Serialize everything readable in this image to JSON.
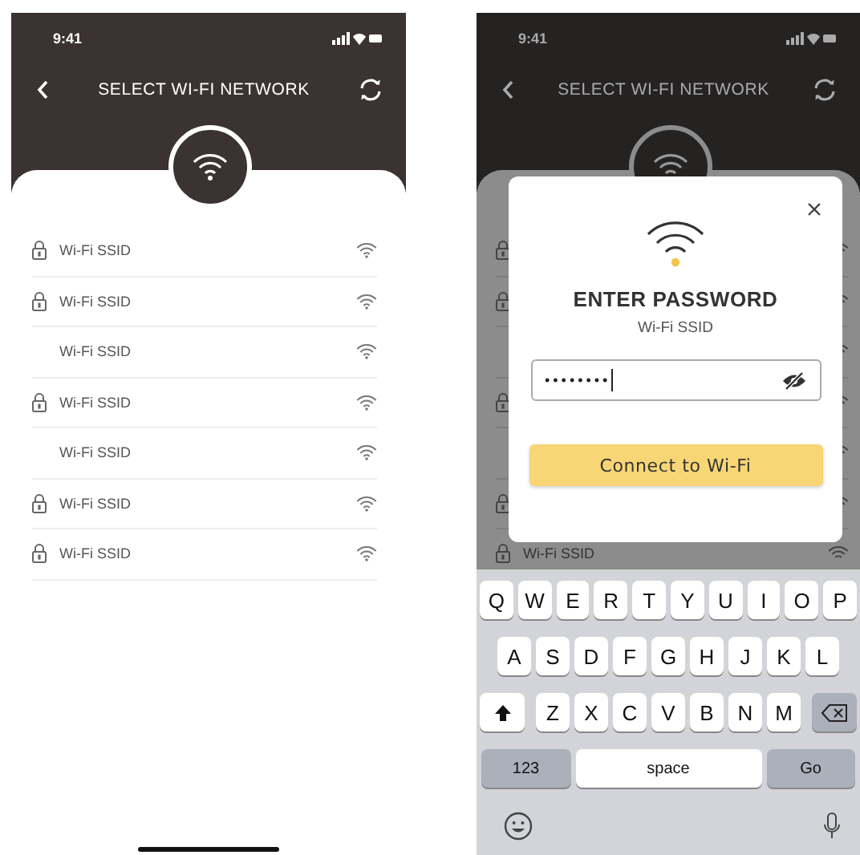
{
  "left": {
    "status_bar": {
      "time": "9:41"
    },
    "header": {
      "title": "SELECT WI-FI NETWORK"
    },
    "networks": [
      {
        "name": "Wi-Fi SSID",
        "locked": true
      },
      {
        "name": "Wi-Fi SSID",
        "locked": true
      },
      {
        "name": "Wi-Fi SSID",
        "locked": false
      },
      {
        "name": "Wi-Fi SSID",
        "locked": true
      },
      {
        "name": "Wi-Fi SSID",
        "locked": false
      },
      {
        "name": "Wi-Fi SSID",
        "locked": true
      },
      {
        "name": "Wi-Fi SSID",
        "locked": true
      }
    ]
  },
  "right": {
    "status_bar": {
      "time": "9:41"
    },
    "header": {
      "title": "SELECT WI-FI NETWORK"
    },
    "background_rows": [
      {
        "locked": true
      },
      {
        "locked": true
      },
      {
        "locked": false
      },
      {
        "locked": true
      },
      {
        "locked": false
      },
      {
        "locked": true
      },
      {
        "locked": true,
        "name": "Wi-Fi SSID"
      }
    ],
    "dialog": {
      "title": "ENTER PASSWORD",
      "subtitle": "Wi-Fi SSID",
      "password": "••••••••",
      "button": "Connect to Wi-Fi"
    },
    "keyboard": {
      "letter_rows": [
        [
          {
            "kind": "letter",
            "label": "Q"
          },
          {
            "kind": "letter",
            "label": "W"
          },
          {
            "kind": "letter",
            "label": "E"
          },
          {
            "kind": "letter",
            "label": "R"
          },
          {
            "kind": "letter",
            "label": "T"
          },
          {
            "kind": "letter",
            "label": "Y"
          },
          {
            "kind": "letter",
            "label": "U"
          },
          {
            "kind": "letter",
            "label": "I"
          },
          {
            "kind": "letter",
            "label": "O"
          },
          {
            "kind": "letter",
            "label": "P"
          }
        ],
        [
          {
            "kind": "letter",
            "label": "A"
          },
          {
            "kind": "letter",
            "label": "S"
          },
          {
            "kind": "letter",
            "label": "D"
          },
          {
            "kind": "letter",
            "label": "F"
          },
          {
            "kind": "letter",
            "label": "G"
          },
          {
            "kind": "letter",
            "label": "H"
          },
          {
            "kind": "letter",
            "label": "J"
          },
          {
            "kind": "letter",
            "label": "K"
          },
          {
            "kind": "letter",
            "label": "L"
          }
        ],
        [
          {
            "kind": "shift"
          },
          {
            "kind": "letter",
            "label": "Z"
          },
          {
            "kind": "letter",
            "label": "X"
          },
          {
            "kind": "letter",
            "label": "C"
          },
          {
            "kind": "letter",
            "label": "V"
          },
          {
            "kind": "letter",
            "label": "B"
          },
          {
            "kind": "letter",
            "label": "N"
          },
          {
            "kind": "letter",
            "label": "M"
          },
          {
            "kind": "delete"
          }
        ]
      ],
      "bottom_keys": [
        {
          "kind": "numbers",
          "label": "123"
        },
        {
          "kind": "space",
          "label": "space"
        },
        {
          "kind": "go",
          "label": "Go"
        }
      ]
    }
  }
}
